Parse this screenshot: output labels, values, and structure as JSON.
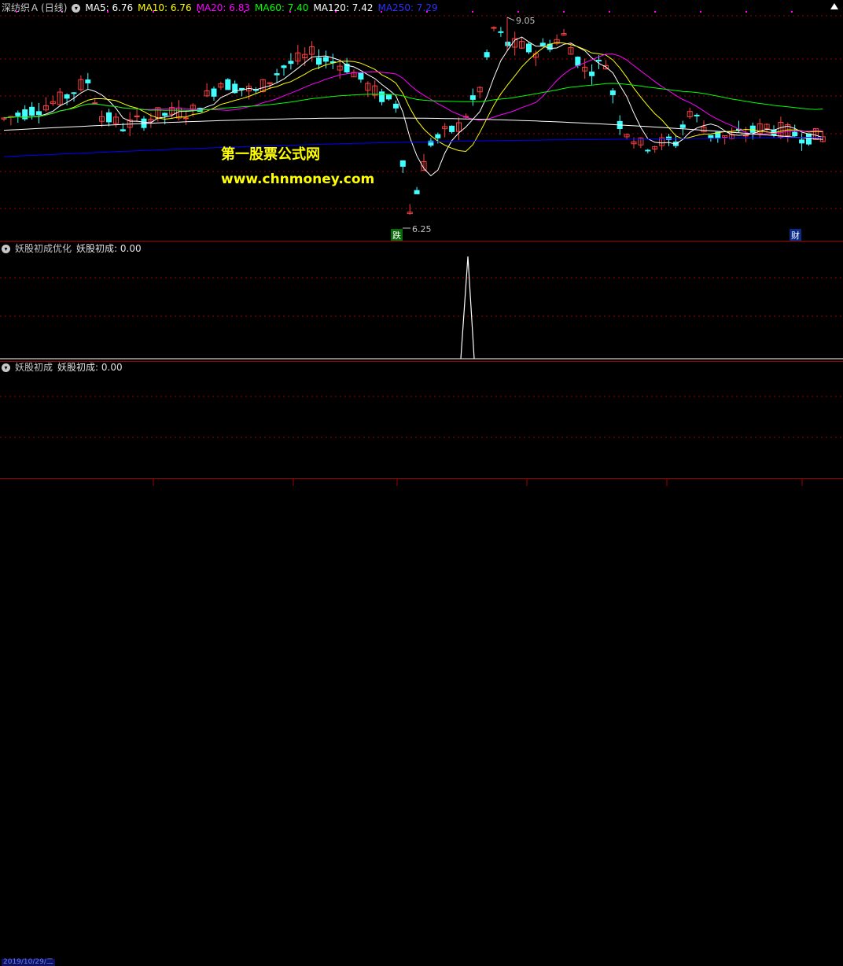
{
  "main": {
    "stock_name": "深纺织Ａ",
    "period": "(日线)",
    "ma": [
      {
        "label": "MA5: 6.76",
        "color": "#ffffff"
      },
      {
        "label": "MA10: 6.76",
        "color": "#ffff00"
      },
      {
        "label": "MA20: 6.83",
        "color": "#ff00ff"
      },
      {
        "label": "MA60: 7.40",
        "color": "#00ff00"
      },
      {
        "label": "MA120: 7.42",
        "color": "#ffffff"
      },
      {
        "label": "MA250: 7.29",
        "color": "#0000ff"
      }
    ],
    "high_label": "9.05",
    "low_label": "6.25",
    "signal_die": "跌",
    "signal_cai": "财"
  },
  "watermark": {
    "title": "第一股票公式网",
    "url": "www.chnmoney.com"
  },
  "indicator1": {
    "name": "妖股初成优化",
    "value_label": "妖股初成: 0.00"
  },
  "indicator2": {
    "name": "妖股初成",
    "value_label": "妖股初成: 0.00"
  },
  "axis": {
    "date": "2019/10/29/二"
  },
  "colors": {
    "up": "#ff4040",
    "down": "#40ffff",
    "grid": "#a00000",
    "ma5": "#ffffff",
    "ma10": "#ffff00",
    "ma20": "#ff00ff",
    "ma60": "#00ff00",
    "ma120": "#ffffff",
    "ma250": "#0000ff"
  },
  "icons": {
    "collapse": "circle-chevron-icon",
    "expand_top": "triangle-up-icon"
  }
}
